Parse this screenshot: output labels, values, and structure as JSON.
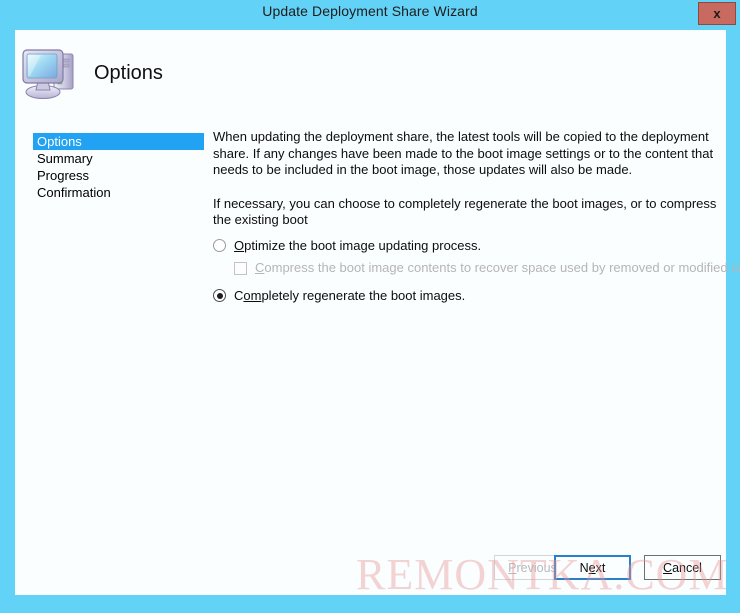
{
  "window": {
    "title": "Update Deployment Share Wizard",
    "close_label": "x",
    "titlebar_color": "#63d2f7",
    "client_color": "#fbfeff",
    "close_button_color": "#c96a61"
  },
  "header": {
    "title": "Options",
    "icon": "computer-icon"
  },
  "sidebar": {
    "items": [
      {
        "label": "Options",
        "selected": true
      },
      {
        "label": "Summary",
        "selected": false
      },
      {
        "label": "Progress",
        "selected": false
      },
      {
        "label": "Confirmation",
        "selected": false
      }
    ],
    "selected_color": "#22a2f2"
  },
  "main": {
    "paragraph1": "When updating the deployment share, the latest tools will be copied to the deployment share.  If any changes have been made to the boot image settings or to the content that needs to be included in the boot image, those updates will also be made.",
    "paragraph2": "If necessary, you can choose to completely regenerate the boot images, or to compress the existing boot"
  },
  "options": {
    "optimize": {
      "accelerator": "O",
      "label_rest": "ptimize the boot image updating process.",
      "checked": false,
      "disabled": false,
      "control": "radio"
    },
    "compress": {
      "accelerator": "C",
      "label_rest": "ompress the boot image contents to recover space used by removed or modified content.",
      "checked": false,
      "disabled": true,
      "control": "checkbox"
    },
    "regenerate": {
      "label_pre": "C",
      "accelerator": "om",
      "label_rest": "pletely regenerate the boot images.",
      "checked": true,
      "disabled": false,
      "control": "radio"
    }
  },
  "buttons": {
    "previous": {
      "accelerator": "P",
      "label_rest": "revious",
      "disabled": true
    },
    "next": {
      "label_pre": "N",
      "accelerator": "e",
      "label_rest": "xt",
      "focused": true
    },
    "cancel": {
      "accelerator": "C",
      "label_rest": "ancel",
      "focused": false
    }
  },
  "watermark": {
    "text": "REMONTKA.COM",
    "color": "#e89696"
  }
}
